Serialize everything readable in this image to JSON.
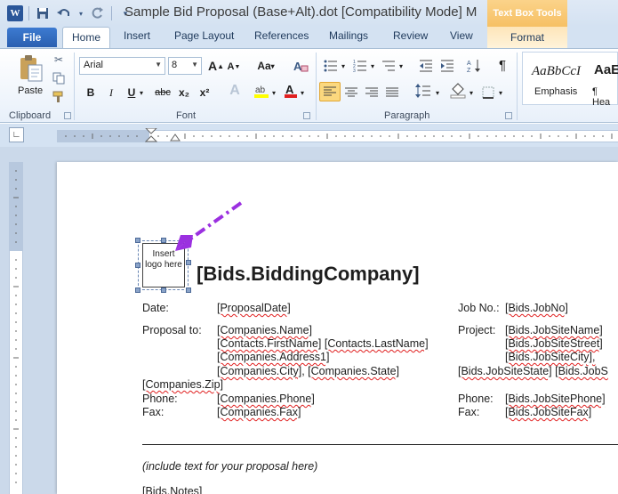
{
  "titlebar": {
    "title": "Sample Bid Proposal (Base+Alt).dot [Compatibility Mode]  M",
    "context_tab": "Text Box Tools",
    "app_icon": "W"
  },
  "tabs": {
    "file": "File",
    "home": "Home",
    "insert": "Insert",
    "page_layout": "Page Layout",
    "references": "References",
    "mailings": "Mailings",
    "review": "Review",
    "view": "View",
    "format": "Format"
  },
  "ribbon": {
    "clipboard": {
      "label": "Clipboard",
      "paste": "Paste"
    },
    "font": {
      "label": "Font",
      "font_name": "Arial",
      "font_size": "8",
      "bold": "B",
      "italic": "I",
      "underline": "U",
      "strike": "abc",
      "subscript": "x₂",
      "superscript": "x²",
      "grow": "A",
      "shrink": "A",
      "case": "Aa",
      "clear": "A",
      "color": "A"
    },
    "paragraph": {
      "label": "Paragraph"
    },
    "styles": {
      "style1_preview": "AaBbCcI",
      "style1_name": "Emphasis",
      "style2_preview": "AaE",
      "style2_name": "¶ Hea"
    }
  },
  "document": {
    "logo_text": "Insert logo here",
    "heading": "[Bids.BiddingCompany]",
    "date_label": "Date:",
    "date_value": "[ProposalDate]",
    "jobno_label": "Job No.:",
    "jobno_value": "[Bids.JobNo]",
    "proposal_label": "Proposal to:",
    "company_name": "[Companies.Name]",
    "contact_first": "[Contacts.FirstName]",
    "contact_last": "[Contacts.LastName]",
    "address1": "[Companies.Address1]",
    "city": "[Companies.City]",
    "state": "[Companies.State]",
    "zip": "[Companies.Zip]",
    "project_label": "Project:",
    "site_name": "[Bids.JobSiteName]",
    "site_street": "[Bids.JobSiteStreet]",
    "site_city": "[Bids.JobSiteCity],",
    "site_state": "[Bids.JobSiteState]",
    "site_zip": "[Bids.JobS",
    "phone_label": "Phone:",
    "phone_value": "[Companies.Phone]",
    "fax_label": "Fax:",
    "fax_value": "[Companies.Fax]",
    "site_phone_label": "Phone:",
    "site_phone_value": "[Bids.JobSitePhone]",
    "site_fax_label": "Fax:",
    "site_fax_value": "[Bids.JobSiteFax]",
    "proposal_text": "(include text for your proposal here)",
    "notes": "[Bids.Notes]"
  },
  "colors": {
    "accent_file_tab": "#2a5fb0",
    "annotation_arrow": "#9b30e0",
    "context_tab": "#f6c064"
  }
}
